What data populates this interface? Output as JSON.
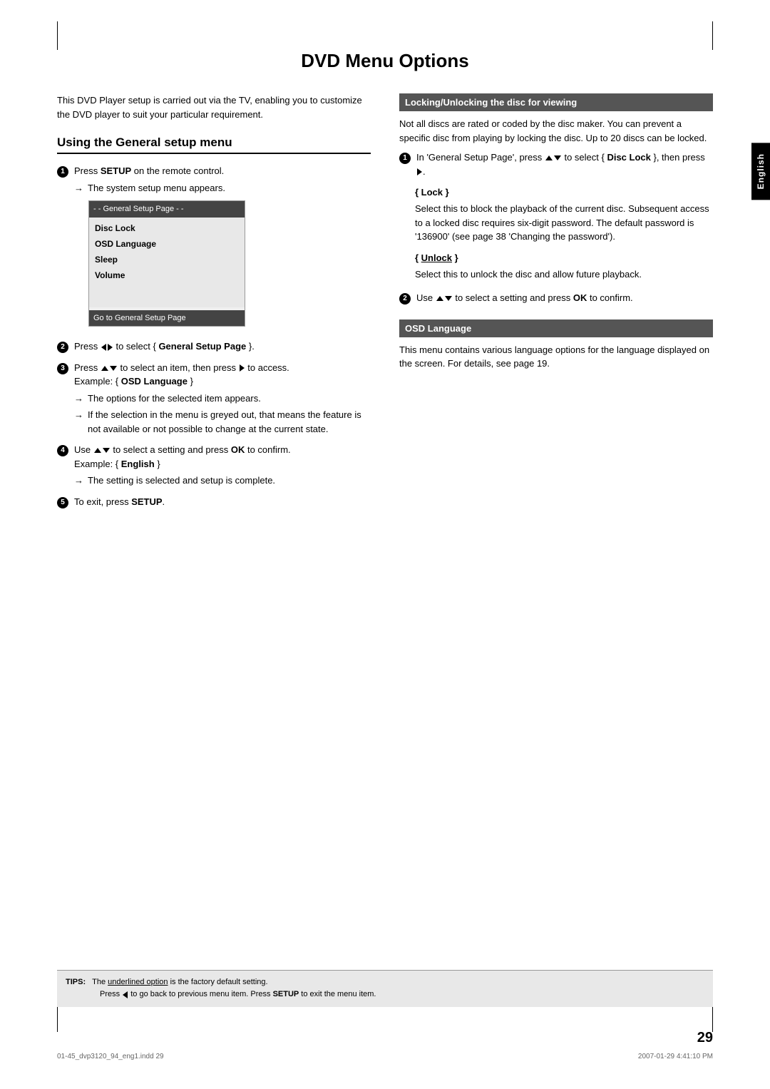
{
  "page": {
    "title": "DVD Menu Options",
    "side_tab": "English",
    "page_number": "29",
    "footer_left": "01-45_dvp3120_94_eng1.indd  29",
    "footer_right": "2007-01-29  4:41:10 PM"
  },
  "left_column": {
    "intro": "This DVD Player setup is carried out via the TV, enabling you to customize the DVD player to suit your particular requirement.",
    "section_heading": "Using the General setup menu",
    "steps": [
      {
        "num": "1",
        "text": "Press SETUP on the remote control.",
        "sub": "→ The system setup menu appears."
      },
      {
        "num": "2",
        "text": "Press ◄ ► to select { General Setup Page }."
      },
      {
        "num": "3",
        "text": "Press ▲ ▼ to select an item, then press ► to access.",
        "example": "Example: { OSD Language }",
        "subs": [
          "→ The options for the selected item appears.",
          "→ If the selection in the menu is greyed out, that means the feature is not available or not possible to change at the current state."
        ]
      },
      {
        "num": "4",
        "text": "Use ▲ ▼ to select a setting and press OK to confirm.",
        "example": "Example: { English }",
        "subs": [
          "→ The setting is selected and setup is complete."
        ]
      },
      {
        "num": "5",
        "text": "To exit, press SETUP."
      }
    ],
    "screen": {
      "title_left": "- -  General Setup Page  - -",
      "items": [
        "Disc Lock",
        "OSD Language",
        "Sleep",
        "Volume"
      ],
      "bottom": "Go to General Setup Page"
    }
  },
  "right_column": {
    "section1": {
      "heading": "Locking/Unlocking the disc for viewing",
      "intro": "Not all discs are rated or coded by the disc maker. You can prevent a specific disc from playing by locking the disc. Up to 20 discs can be locked.",
      "step1": "In 'General Setup Page', press ▲ ▼ to select { Disc Lock }, then press ►.",
      "lock_heading": "{ Lock }",
      "lock_text": "Select this to block the playback of the current disc. Subsequent access to a locked disc requires six-digit password. The default password is '136900' (see page 38 'Changing the password').",
      "unlock_heading": "{ Unlock }",
      "unlock_text": "Select this to unlock the disc and allow future playback.",
      "step2": "Use ▲ ▼ to select a setting and press OK to confirm."
    },
    "section2": {
      "heading": "OSD Language",
      "text": "This menu contains various language options for the language displayed on the screen. For details, see page 19."
    }
  },
  "tips": {
    "label": "TIPS:",
    "lines": [
      "The underlined option is the factory default setting.",
      "Press ◄ to go back to previous menu item. Press SETUP to exit the menu item."
    ]
  }
}
